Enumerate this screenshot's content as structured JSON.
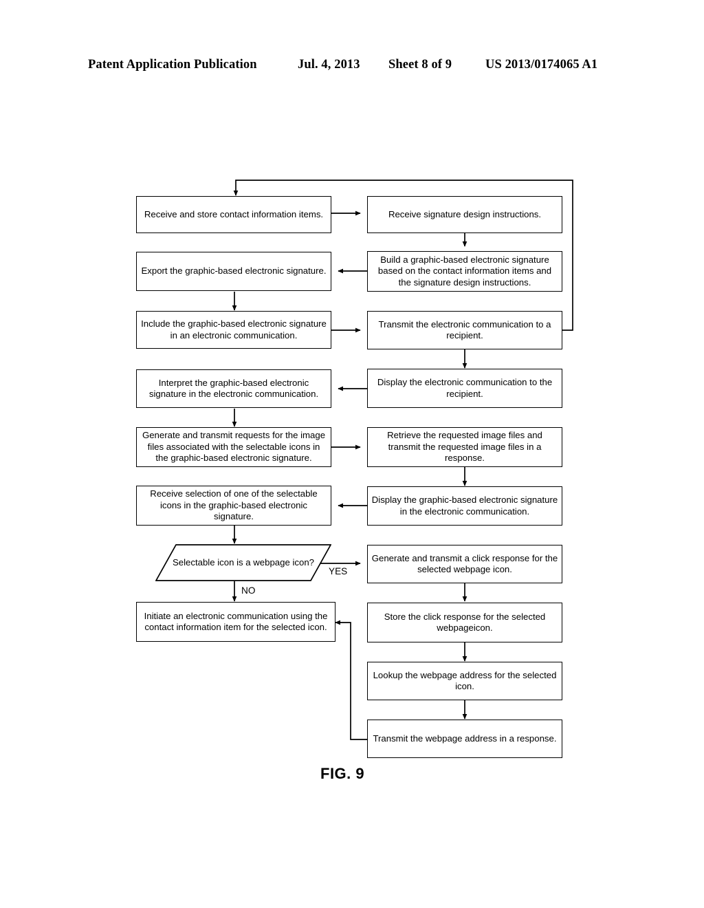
{
  "header": {
    "publication": "Patent Application Publication",
    "date": "Jul. 4, 2013",
    "sheet": "Sheet 8 of 9",
    "patent_number": "US 2013/0174065 A1"
  },
  "figure": {
    "label": "FIG. 9",
    "type": "flowchart",
    "line_color": "#000000",
    "background_color": "#ffffff"
  },
  "nodes": [
    {
      "id": "n1",
      "shape": "process",
      "text": "Receive and store contact information items."
    },
    {
      "id": "n2",
      "shape": "process",
      "text": "Receive signature design instructions."
    },
    {
      "id": "n3",
      "shape": "process",
      "text": "Export the graphic-based electronic signature."
    },
    {
      "id": "n4",
      "shape": "process",
      "text": "Build a graphic-based electronic signature based on the contact information items and the signature design instructions."
    },
    {
      "id": "n5",
      "shape": "process",
      "text": "Include the graphic-based electronic signature in an electronic communication."
    },
    {
      "id": "n6",
      "shape": "process",
      "text": "Transmit the electronic communication to a recipient."
    },
    {
      "id": "n7",
      "shape": "process",
      "text": "Interpret the graphic-based electronic signature in the electronic communication."
    },
    {
      "id": "n8",
      "shape": "process",
      "text": "Display the electronic communication to the recipient."
    },
    {
      "id": "n9",
      "shape": "process",
      "text": "Generate and transmit requests for the image files associated with the selectable icons in the graphic-based electronic signature."
    },
    {
      "id": "n10",
      "shape": "process",
      "text": "Retrieve the requested image files and transmit the requested image files in a response."
    },
    {
      "id": "n11",
      "shape": "process",
      "text": "Receive selection of one of the selectable icons in the graphic-based electronic signature."
    },
    {
      "id": "n12",
      "shape": "process",
      "text": "Display the graphic-based electronic signature in the electronic communication."
    },
    {
      "id": "n13",
      "shape": "decision",
      "text": "Selectable icon is a webpage icon?"
    },
    {
      "id": "n14",
      "shape": "process",
      "text": "Generate and transmit a click response for the selected webpage icon."
    },
    {
      "id": "n15",
      "shape": "process",
      "text": "Initiate an electronic communication using the contact information item for the selected icon."
    },
    {
      "id": "n16",
      "shape": "process",
      "text": "Store the click response for the selected webpageicon."
    },
    {
      "id": "n17",
      "shape": "process",
      "text": "Lookup the webpage address for the selected icon."
    },
    {
      "id": "n18",
      "shape": "process",
      "text": "Transmit the webpage address in a response."
    }
  ],
  "edge_labels": {
    "yes": "YES",
    "no": "NO"
  },
  "edges": [
    {
      "from": "n1",
      "to": "n2",
      "label": ""
    },
    {
      "from": "n2",
      "to": "n4",
      "label": ""
    },
    {
      "from": "n4",
      "to": "n3",
      "label": ""
    },
    {
      "from": "n3",
      "to": "n5",
      "label": ""
    },
    {
      "from": "n5",
      "to": "n6",
      "label": ""
    },
    {
      "from": "n6",
      "to": "n1",
      "label": ""
    },
    {
      "from": "n6",
      "to": "n8",
      "label": ""
    },
    {
      "from": "n8",
      "to": "n7",
      "label": ""
    },
    {
      "from": "n7",
      "to": "n9",
      "label": ""
    },
    {
      "from": "n9",
      "to": "n10",
      "label": ""
    },
    {
      "from": "n10",
      "to": "n12",
      "label": ""
    },
    {
      "from": "n12",
      "to": "n11",
      "label": ""
    },
    {
      "from": "n11",
      "to": "n13",
      "label": ""
    },
    {
      "from": "n13",
      "to": "n14",
      "label": "YES"
    },
    {
      "from": "n13",
      "to": "n15",
      "label": "NO"
    },
    {
      "from": "n14",
      "to": "n16",
      "label": ""
    },
    {
      "from": "n16",
      "to": "n17",
      "label": ""
    },
    {
      "from": "n17",
      "to": "n18",
      "label": ""
    },
    {
      "from": "n18",
      "to": "n15",
      "label": ""
    }
  ]
}
